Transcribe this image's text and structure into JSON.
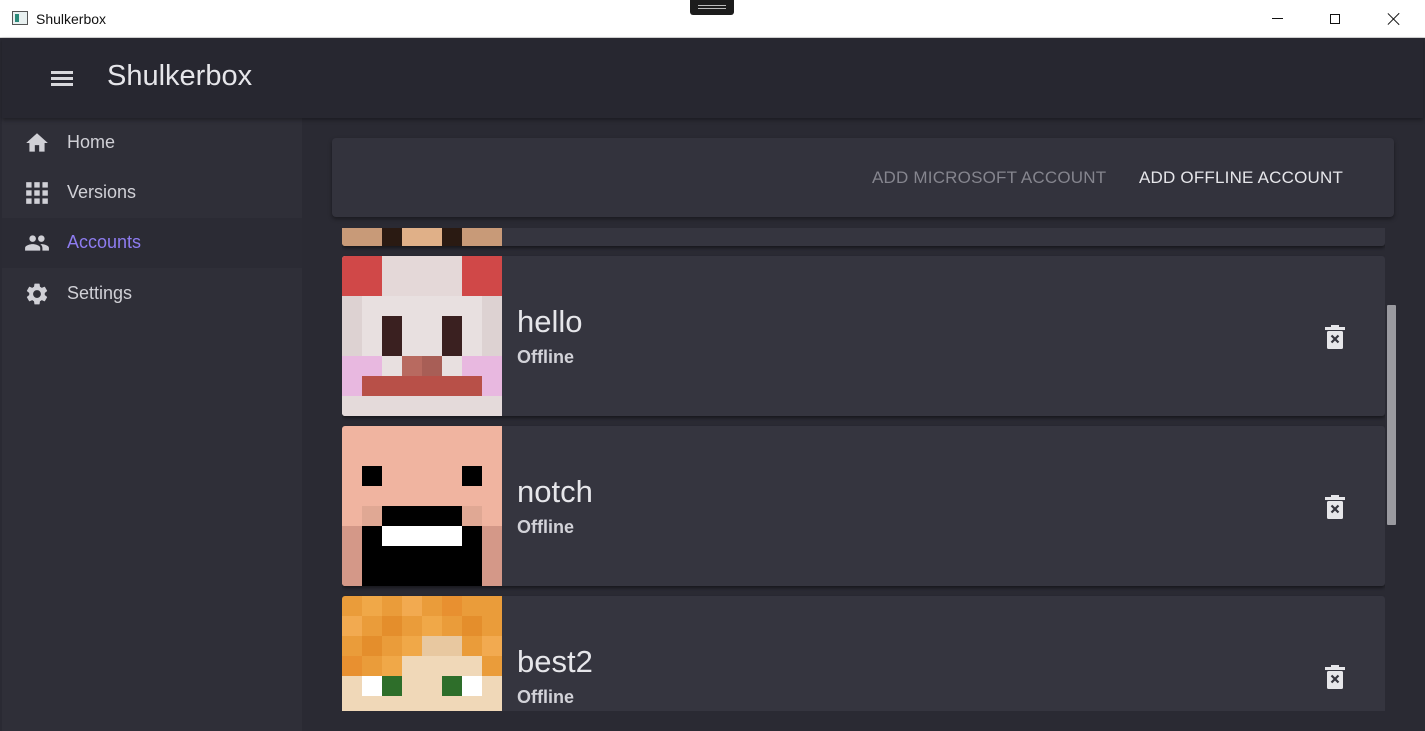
{
  "window": {
    "title": "Shulkerbox"
  },
  "appbar": {
    "title": "Shulkerbox"
  },
  "sidebar": {
    "items": [
      {
        "label": "Home",
        "icon": "home-icon",
        "active": false
      },
      {
        "label": "Versions",
        "icon": "grid-icon",
        "active": false
      },
      {
        "label": "Accounts",
        "icon": "people-icon",
        "active": true
      },
      {
        "label": "Settings",
        "icon": "gear-icon",
        "active": false
      }
    ]
  },
  "toolbar": {
    "add_microsoft_label": "ADD MICROSOFT ACCOUNT",
    "add_offline_label": "ADD OFFLINE ACCOUNT"
  },
  "accounts": [
    {
      "name": "",
      "type": ""
    },
    {
      "name": "hello",
      "type": "Offline"
    },
    {
      "name": "notch",
      "type": "Offline"
    },
    {
      "name": "best2",
      "type": "Offline"
    }
  ],
  "colors": {
    "accent": "#8e7cf0",
    "background": "#2a2a33",
    "sidebar": "#2f2f38",
    "card": "#35353f"
  }
}
